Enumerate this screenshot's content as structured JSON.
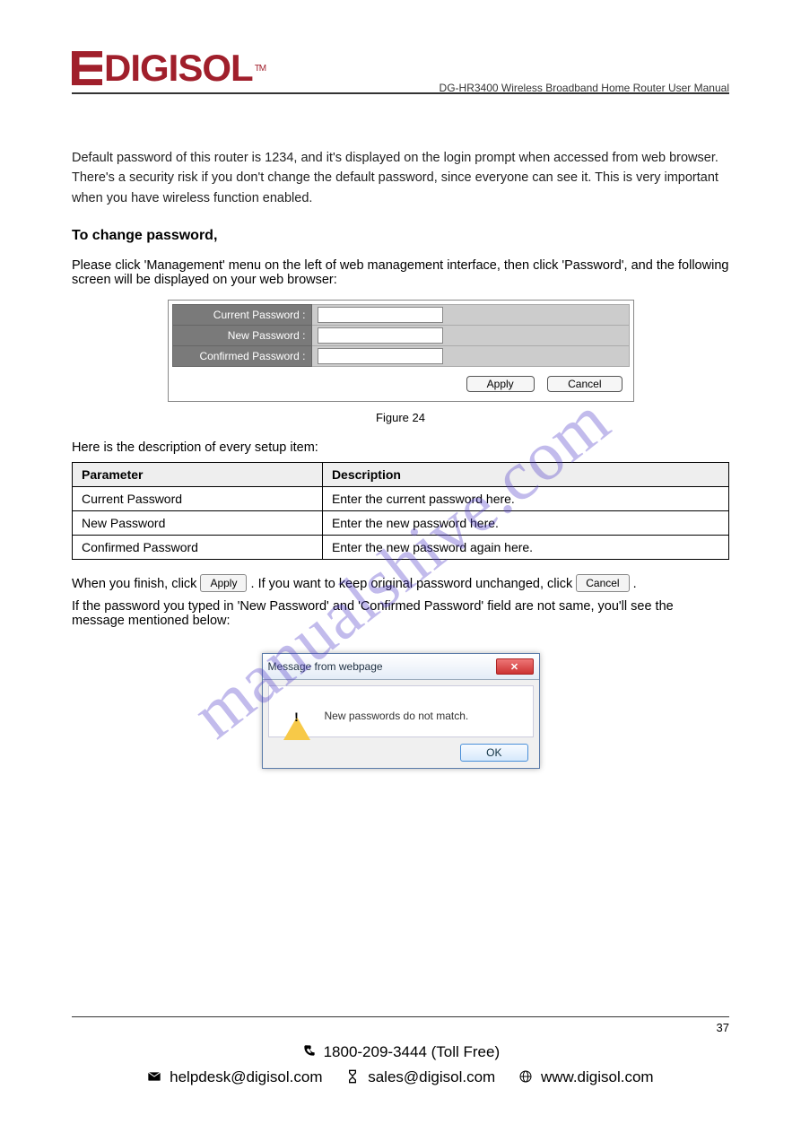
{
  "brand": {
    "name": "DIGISOL",
    "tm": "TM"
  },
  "header_product": "DG-HR3400 Wireless Broadband Home Router User Manual",
  "intro_text": "Default password of this router is 1234, and it's displayed on the login prompt when accessed from web browser. There's a security risk if you don't change the default password, since everyone can see it. This is very important when you have wireless function enabled.",
  "section_heading": "To change password,",
  "instruction_text": "Please click 'Management' menu on the left of web management interface, then click 'Password', and the following screen will be displayed on your web browser:",
  "form": {
    "row1_label": "Current Password :",
    "row2_label": "New Password :",
    "row3_label": "Confirmed Password :",
    "apply": "Apply",
    "cancel": "Cancel"
  },
  "figure_label": "Figure 24",
  "table_intro": "Here is the description of every setup item:",
  "table": {
    "h1": "Parameter",
    "h2": "Description",
    "r1c1": "Current Password",
    "r1c2": "Enter the current password here.",
    "r2c1": "New Password",
    "r2c2": "Enter the new password here.",
    "r3c1": "Confirmed Password",
    "r3c2": "Enter the new password again here."
  },
  "after_table_1_prefix": "When you finish, click ",
  "after_table_1_btn": "Apply",
  "after_table_1_suffix": ". If you want to keep original password unchanged, click ",
  "after_table_1_btn2": "Cancel",
  "after_table_1_end": ".",
  "mismatch_text": "If the password you typed in 'New Password' and 'Confirmed Password' field are not same, you'll see the message mentioned below:",
  "dialog": {
    "title": "Message from webpage",
    "message": "New passwords do not match.",
    "ok": "OK"
  },
  "watermark": "manualshive.com",
  "footer": {
    "page": "37",
    "phone": "1800-209-3444 (Toll Free)",
    "helpdesk": "helpdesk@digisol.com",
    "sales": "sales@digisol.com",
    "site": "www.digisol.com"
  }
}
